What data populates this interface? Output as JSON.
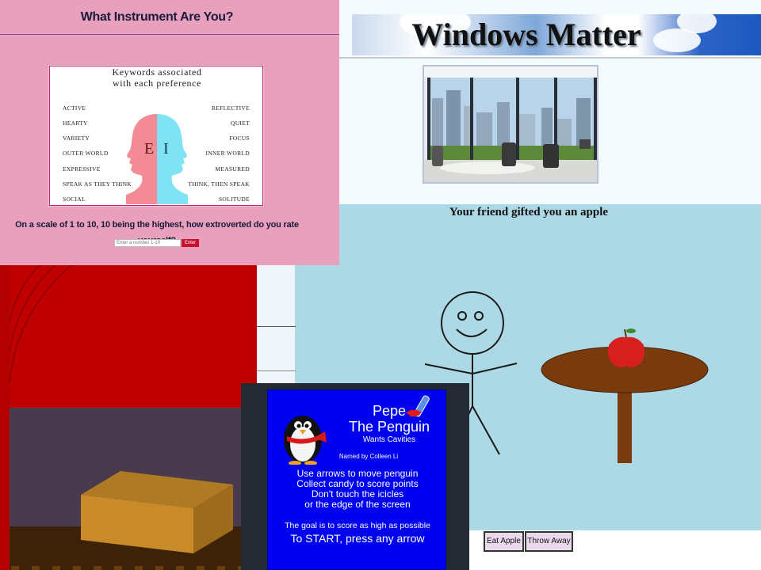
{
  "instrument_quiz": {
    "title": "What Instrument Are You?",
    "card_heading_line1": "Keywords associated",
    "card_heading_line2": "with each  preference",
    "left_keywords": [
      "ACTIVE",
      "HEARTY",
      "VARIETY",
      "OUTER WORLD",
      "EXPRESSIVE",
      "SPEAK AS THEY THINK",
      "SOCIAL"
    ],
    "right_keywords": [
      "REFLECTIVE",
      "QUIET",
      "FOCUS",
      "INNER WORLD",
      "MEASURED",
      "THINK, THEN SPEAK",
      "SOLITUDE"
    ],
    "letter_e": "E",
    "letter_i": "I",
    "question": "On a scale of 1 to 10, 10 being the highest, how extroverted do you rate yourself?",
    "input_placeholder": "Enter a number 1-10",
    "enter_label": "Enter",
    "colors": {
      "background": "#e8a0bc",
      "enter_button": "#c8102e",
      "head_left": "#f28b95",
      "head_right": "#7fe3f3"
    }
  },
  "windows_matter": {
    "title": "Windows Matter"
  },
  "apple_game": {
    "message": "Your friend gifted you an apple",
    "buttons": [
      "Eat Apple",
      "Throw Away"
    ],
    "colors": {
      "background": "#add8e6",
      "table": "#7a3b0c",
      "apple": "#d81f1f"
    }
  },
  "penguin_game": {
    "title_line1": "Pepe",
    "title_line2": "The Penguin",
    "subtitle": "Wants Cavities",
    "credit": "Named by Colleen Li",
    "instructions": [
      "Use arrows to move penguin",
      "Collect candy to score points",
      "Don't touch the icicles",
      "or the edge of the screen"
    ],
    "goal": "The goal is to score as high as possible",
    "start": "To START, press any arrow",
    "colors": {
      "background": "#0000f0",
      "frame": "#232a32"
    }
  },
  "stage_scene": {
    "colors": {
      "curtain": "#c00000",
      "wall": "#4a3a4e",
      "floor": "#3c2308",
      "box": "#c98a2a"
    }
  }
}
